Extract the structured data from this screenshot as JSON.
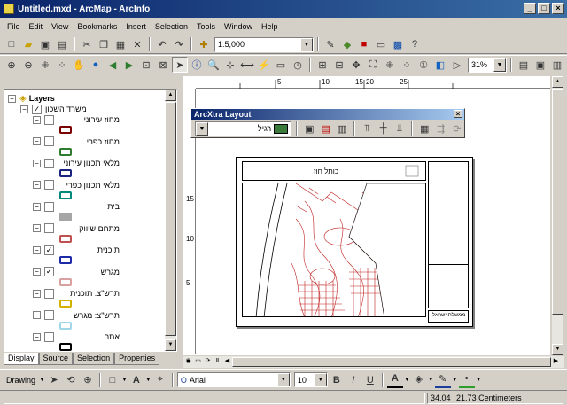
{
  "window": {
    "title": "Untitled.mxd - ArcMap - ArcInfo",
    "minimize": "_",
    "maximize": "□",
    "close": "×"
  },
  "menu": [
    "File",
    "Edit",
    "View",
    "Bookmarks",
    "Insert",
    "Selection",
    "Tools",
    "Window",
    "Help"
  ],
  "standard_toolbar": {
    "scale_value": "1:5,000"
  },
  "layout_toolbar": {
    "zoom_value": "31%"
  },
  "toc": {
    "root_label": "Layers",
    "group_label": "משרד השכון",
    "layers": [
      {
        "name": "מחוז עירוני",
        "checked": false,
        "color": "#7a0000",
        "fill": "none"
      },
      {
        "name": "מחוז כפרי",
        "checked": false,
        "color": "#2e7d2e",
        "fill": "none"
      },
      {
        "name": "מלאי תכנון עירוני",
        "checked": false,
        "color": "#1a237e",
        "fill": "none"
      },
      {
        "name": "מלאי תכנון כפרי",
        "checked": false,
        "color": "#00897b",
        "fill": "none"
      },
      {
        "name": "בית",
        "checked": false,
        "color": "#a6a6a6",
        "fill": "solid"
      },
      {
        "name": "מתחם שיווק",
        "checked": false,
        "color": "#c0504d",
        "fill": "none"
      },
      {
        "name": "תוכנית",
        "checked": true,
        "color": "#1e2aa8",
        "fill": "none"
      },
      {
        "name": "מגרש",
        "checked": true,
        "color": "#d9a0a0",
        "fill": "none"
      },
      {
        "name": "תרש\"צ: תוכנית",
        "checked": false,
        "color": "#d4b000",
        "fill": "none"
      },
      {
        "name": "תרש\"צ: מגרש",
        "checked": false,
        "color": "#9fd6e8",
        "fill": "none"
      },
      {
        "name": "אתר",
        "checked": false,
        "color": "#000000",
        "fill": "none"
      }
    ],
    "tabs": [
      "Display",
      "Source",
      "Selection",
      "Properties"
    ]
  },
  "rulers": {
    "h_labels": [
      "5",
      "10",
      "15",
      "20",
      "25"
    ],
    "v_labels": [
      "15",
      "10",
      "5"
    ]
  },
  "palette": {
    "title": "ArcXtra Layout",
    "combo_value": "רגיל"
  },
  "layout": {
    "map_title": "כותל חוז",
    "footer_text": "ממשלת ישראל"
  },
  "drawing_toolbar": {
    "drawing_label": "Drawing",
    "font_name": "Arial",
    "font_size": "10",
    "bold": "B",
    "italic": "I",
    "underline": "U"
  },
  "status": {
    "coord_x": "34.04",
    "coord_y_units": "21.73 Centimeters"
  }
}
